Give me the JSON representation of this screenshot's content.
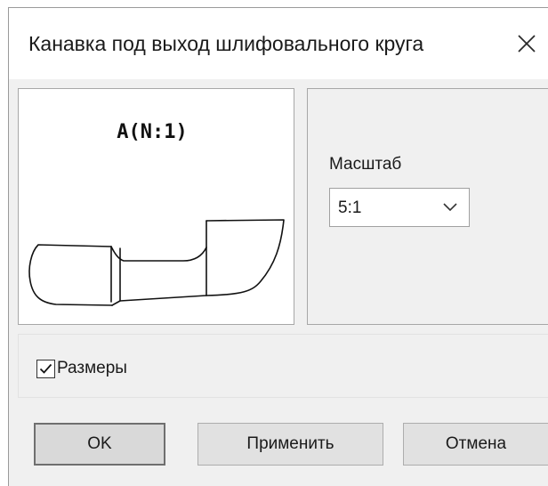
{
  "dialog": {
    "title": "Канавка под выход шлифовального круга"
  },
  "preview": {
    "view_label": "A(N:1)"
  },
  "settings": {
    "scale_label": "Масштаб",
    "scale_value": "5:1"
  },
  "options": {
    "dimensions_label": "Размеры",
    "dimensions_checked": true
  },
  "buttons": {
    "ok_label": "OK",
    "apply_label": "Применить",
    "cancel_label": "Отмена"
  },
  "icons": {
    "close": "close-icon",
    "chevron": "chevron-down-icon",
    "check": "checkmark-icon"
  }
}
